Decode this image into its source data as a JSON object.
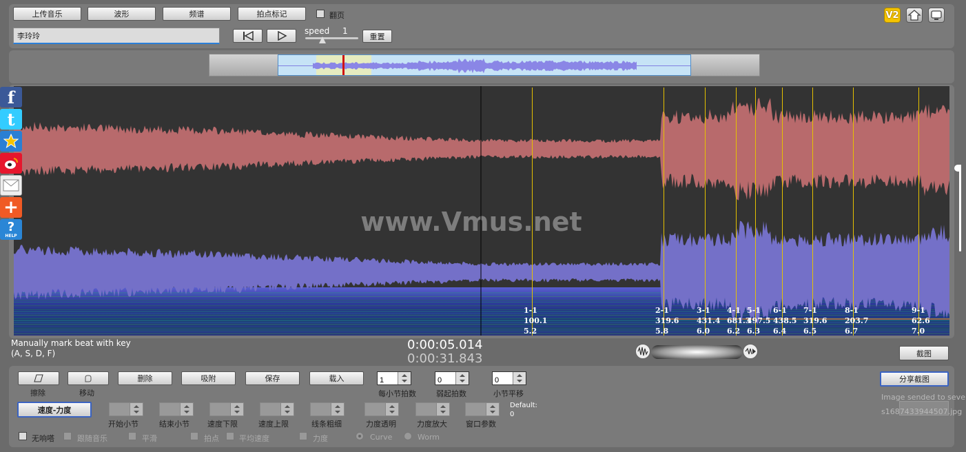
{
  "toolbar": {
    "upload_label": "上传音乐",
    "waveform_label": "波形",
    "spectrum_label": "频谱",
    "beat_mark_label": "拍点标记",
    "flip_label": "翻页",
    "song_title": "李玲玲",
    "speed_label": "speed",
    "speed_value": "1",
    "reset_label": "重置",
    "version_badge": "V2"
  },
  "waveform": {
    "watermark": "www.Vmus.net",
    "markers": [
      {
        "bar": "1-1",
        "tempo": "100.1",
        "time": "5.2"
      },
      {
        "bar": "2-1",
        "tempo": "319.6",
        "time": "5.8"
      },
      {
        "bar": "3-1",
        "tempo": "431.4",
        "time": "6.0"
      },
      {
        "bar": "4-1",
        "tempo": "681.3",
        "time": "6.2"
      },
      {
        "bar": "5-1",
        "tempo": "497.5",
        "time": "6.3"
      },
      {
        "bar": "6-1",
        "tempo": "438.5",
        "time": "6.4"
      },
      {
        "bar": "7-1",
        "tempo": "319.6",
        "time": "6.5"
      },
      {
        "bar": "8-1",
        "tempo": "203.7",
        "time": "6.7"
      },
      {
        "bar": "9-1",
        "tempo": "62.6",
        "time": "7.0"
      }
    ]
  },
  "status": {
    "hint_line1": "Manually mark beat with key",
    "hint_line2": "(A, S, D, F)",
    "current_time": "0:00:05.014",
    "total_time": "0:00:31.843",
    "screenshot_label": "截图"
  },
  "bottom": {
    "erase_label": "擦除",
    "move_label": "移动",
    "delete_label": "删除",
    "snap_label": "吸附",
    "save_label": "保存",
    "load_label": "载入",
    "beats_per_bar_value": "1",
    "beats_per_bar_label": "每小节拍数",
    "pickup_value": "0",
    "pickup_label": "弱起拍数",
    "bar_shift_value": "0",
    "bar_shift_label": "小节平移",
    "share_label": "分享截图",
    "image_sent_text": "Image sended to seve",
    "file_id_text": "s1687433944507.jpg",
    "tempo_force_label": "速度-力度",
    "start_bar_label": "开始小节",
    "end_bar_label": "结束小节",
    "tempo_min_label": "速度下限",
    "tempo_max_label": "速度上限",
    "line_width_label": "线条粗细",
    "force_opacity_label": "力度透明",
    "force_scale_label": "力度放大",
    "window_param_label": "窗口参数",
    "default_label": "Default:",
    "default_value": "0",
    "no_pop_label": "无响嗒",
    "follow_music_label": "跟随音乐",
    "smooth_label": "平滑",
    "beat_point_label": "拍点",
    "avg_tempo_label": "平均速度",
    "force_label": "力度",
    "curve_label": "Curve",
    "worm_label": "Worm"
  },
  "social": [
    "facebook-icon",
    "twitter-icon",
    "favorite-icon",
    "weibo-icon",
    "email-icon",
    "add-icon",
    "help-icon"
  ],
  "colors": {
    "waveform_top": "#b86a6c",
    "waveform_bottom": "#7470c8",
    "marker_line": "#e6c200",
    "background": "#333333"
  }
}
